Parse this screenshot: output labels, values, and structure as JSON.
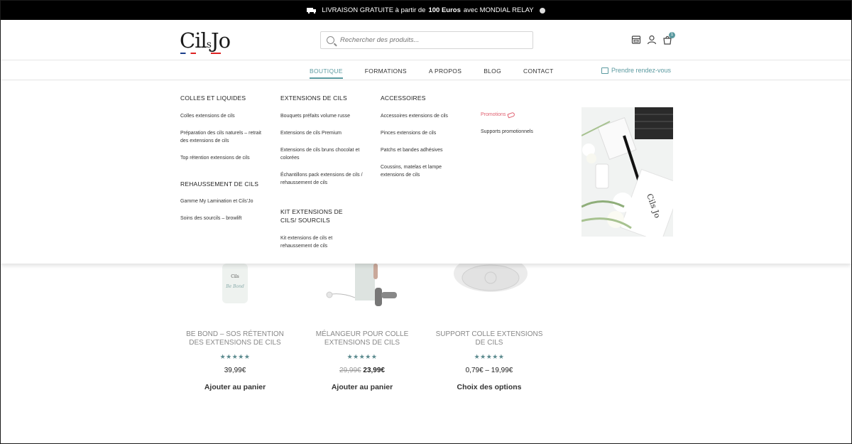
{
  "topbar": {
    "text_before": "LIVRAISON GRATUITE à partir de",
    "amount": "100 Euros",
    "text_after": "avec MONDIAL RELAY"
  },
  "header": {
    "logo_main": "Cil",
    "logo_s": "s",
    "logo_end": "Jo",
    "search_placeholder": "Rechercher des produits...",
    "cart_count": "1"
  },
  "nav": {
    "items": [
      {
        "label": "BOUTIQUE"
      },
      {
        "label": "FORMATIONS"
      },
      {
        "label": "A PROPOS"
      },
      {
        "label": "BLOG"
      },
      {
        "label": "CONTACT"
      }
    ],
    "rdv_label": "Prendre rendez-vous"
  },
  "mega": {
    "col1": {
      "title1": "COLLES ET LIQUIDES",
      "links1": [
        "Colles extensions de cils",
        "Préparation des cils naturels – retrait des extensions de cils",
        "Top rétention extensions de cils"
      ],
      "title2": "REHAUSSEMENT DE CILS",
      "links2": [
        "Gamme My Lamination et Cils'Jo",
        "Soins des sourcils – browlift"
      ]
    },
    "col2": {
      "title1": "EXTENSIONS DE CILS",
      "links1": [
        "Bouquets préfaits volume russe",
        "Extensions de cils Premium",
        "Extensions de cils bruns chocolat et colorées",
        "Échantillons pack extensions de cils / rehaussement de cils"
      ],
      "title2": "KIT EXTENSIONS DE CILS/ SOURCILS",
      "links2": [
        "Kit extensions de cils et rehaussement de cils"
      ]
    },
    "col3": {
      "title1": "ACCESSOIRES",
      "links1": [
        "Accessoires extensions de cils",
        "Pinces extensions de cils",
        "Patchs et bandes adhésives",
        "Coussins, matelas et lampe extensions de cils"
      ]
    },
    "col4": {
      "promo": "Promotions",
      "support": "Supports promotionnels"
    },
    "image_text": "Cils Jo"
  },
  "products": [
    {
      "title": "BE BOND – SOS RÉTENTION DES EXTENSIONS DE CILS",
      "stars": "★★★★★",
      "price": "39,99€",
      "button": "Ajouter au panier",
      "img_label": "Cils.Jo Be Bond"
    },
    {
      "title": "MÉLANGEUR POUR COLLE EXTENSIONS DE CILS",
      "stars": "★★★★★",
      "old_price": "29,99€",
      "new_price": "23,99€",
      "button": "Ajouter au panier"
    },
    {
      "title": "SUPPORT COLLE EXTENSIONS DE CILS",
      "stars": "★★★★★",
      "price_range": "0,79€ – 19,99€",
      "button": "Choix des options"
    }
  ],
  "colors": {
    "accent": "#5b9aa0",
    "promo": "#e06070",
    "topbar": "#000000"
  }
}
